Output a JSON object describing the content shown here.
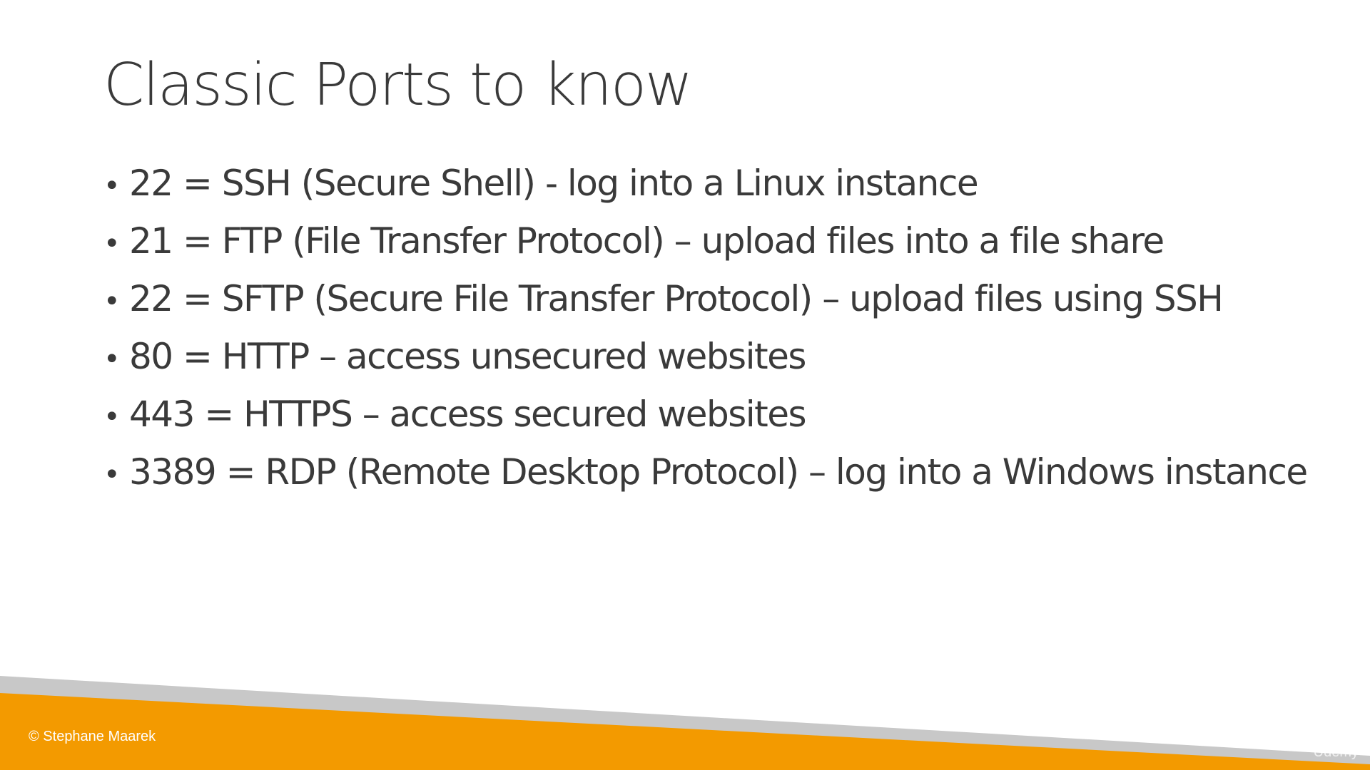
{
  "slide": {
    "title": "Classic Ports to know",
    "bullets": [
      {
        "text": "22 = SSH (Secure Shell) - log into a Linux instance"
      },
      {
        "text": "21 = FTP (File Transfer Protocol) – upload files into a file share"
      },
      {
        "text": "22 = SFTP (Secure File Transfer Protocol) – upload files using SSH"
      },
      {
        "text": "80 = HTTP – access unsecured websites"
      },
      {
        "text": "443 = HTTPS – access secured websites"
      },
      {
        "text": "3389 = RDP (Remote Desktop Protocol) – log into a Windows instance"
      }
    ],
    "bullet_glyph": "•"
  },
  "footer": {
    "copyright": "© Stephane Maarek",
    "watermark": "Udemy",
    "colors": {
      "orange": "#F39A00",
      "gray_stripe": "#C8C8C8"
    }
  }
}
